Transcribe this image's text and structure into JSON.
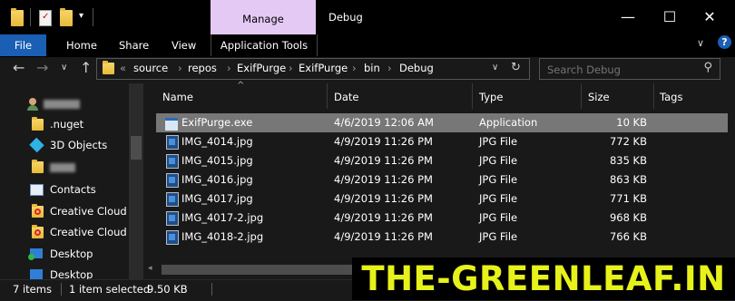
{
  "window": {
    "title": "Debug",
    "manage_tab": "Manage",
    "minimize": "—",
    "maximize": "☐",
    "close": "✕"
  },
  "ribbon": {
    "file": "File",
    "home": "Home",
    "share": "Share",
    "view": "View",
    "application_tools": "Application Tools",
    "expand": "∨",
    "help": "?"
  },
  "address": {
    "overflow": "«",
    "crumbs": [
      "source",
      "repos",
      "ExifPurge",
      "ExifPurge",
      "bin",
      "Debug"
    ],
    "separator": "›",
    "dropdown": "∨",
    "refresh": "↻",
    "back": "←",
    "forward": "→",
    "recent": "∨",
    "up": "↑"
  },
  "search": {
    "placeholder": "Search Debug",
    "icon": "search-icon"
  },
  "nav_pane": {
    "items": [
      {
        "label": "",
        "icon": "user-icon"
      },
      {
        "label": ".nuget",
        "icon": "folder-icon"
      },
      {
        "label": "3D Objects",
        "icon": "3d-objects-icon"
      },
      {
        "label": "",
        "icon": "folder-icon"
      },
      {
        "label": "Contacts",
        "icon": "contacts-icon"
      },
      {
        "label": "Creative Cloud F",
        "icon": "creative-cloud-icon"
      },
      {
        "label": "Creative Cloud F",
        "icon": "creative-cloud-icon"
      },
      {
        "label": "Desktop",
        "icon": "desktop-icon"
      },
      {
        "label": "Desktop",
        "icon": "desktop-icon"
      }
    ]
  },
  "columns": [
    "Name",
    "Date",
    "Type",
    "Size",
    "Tags"
  ],
  "files": [
    {
      "name": "ExifPurge.exe",
      "date": "4/6/2019 12:06 AM",
      "type": "Application",
      "size": "10 KB",
      "selected": true,
      "icon": "application-icon"
    },
    {
      "name": "IMG_4014.jpg",
      "date": "4/9/2019 11:26 PM",
      "type": "JPG File",
      "size": "772 KB",
      "selected": false,
      "icon": "jpg-file-icon"
    },
    {
      "name": "IMG_4015.jpg",
      "date": "4/9/2019 11:26 PM",
      "type": "JPG File",
      "size": "835 KB",
      "selected": false,
      "icon": "jpg-file-icon"
    },
    {
      "name": "IMG_4016.jpg",
      "date": "4/9/2019 11:26 PM",
      "type": "JPG File",
      "size": "863 KB",
      "selected": false,
      "icon": "jpg-file-icon"
    },
    {
      "name": "IMG_4017.jpg",
      "date": "4/9/2019 11:26 PM",
      "type": "JPG File",
      "size": "771 KB",
      "selected": false,
      "icon": "jpg-file-icon"
    },
    {
      "name": "IMG_4017-2.jpg",
      "date": "4/9/2019 11:26 PM",
      "type": "JPG File",
      "size": "968 KB",
      "selected": false,
      "icon": "jpg-file-icon"
    },
    {
      "name": "IMG_4018-2.jpg",
      "date": "4/9/2019 11:26 PM",
      "type": "JPG File",
      "size": "766 KB",
      "selected": false,
      "icon": "jpg-file-icon"
    }
  ],
  "status": {
    "item_count": "7 items",
    "selection": "1 item selected",
    "selection_size": "9.50 KB"
  },
  "watermark": "THE-GREENLEAF.IN",
  "colors": {
    "selection": "#777777",
    "manage_tab": "#e4c9f5",
    "file_tab": "#1a5fb4",
    "watermark": "#e6f21a"
  }
}
